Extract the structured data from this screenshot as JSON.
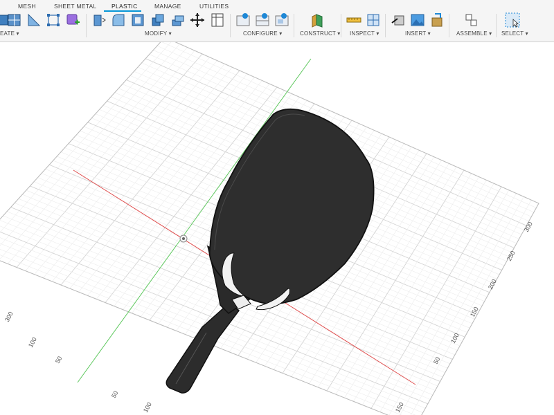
{
  "tabs": [
    {
      "label": "MESH",
      "active": false
    },
    {
      "label": "SHEET METAL",
      "active": false
    },
    {
      "label": "PLASTIC",
      "active": true
    },
    {
      "label": "MANAGE",
      "active": false
    },
    {
      "label": "UTILITIES",
      "active": false
    }
  ],
  "groups": {
    "create": "EATE ▾",
    "modify": "MODIFY ▾",
    "configure": "CONFIGURE ▾",
    "construct": "CONSTRUCT ▾",
    "inspect": "INSPECT ▾",
    "insert": "INSERT ▾",
    "assemble": "ASSEMBLE ▾",
    "select": "SELECT ▾"
  },
  "icons": {
    "create": [
      "box-icon",
      "sketch-grid-icon",
      "revolve-icon",
      "bounding-box-icon",
      "solid-add-icon"
    ],
    "modify": [
      "press-pull-icon",
      "fillet-icon",
      "shell-icon",
      "combine-icon",
      "move-icon",
      "align-icon"
    ],
    "configure": [
      "configure-table-icon",
      "configure-rule-icon",
      "configure-theme-icon"
    ],
    "construct": [
      "offset-plane-icon"
    ],
    "inspect": [
      "measure-icon",
      "section-analysis-icon"
    ],
    "insert": [
      "insert-derive-icon",
      "insert-image-icon",
      "insert-mcmaster-icon"
    ],
    "assemble": [
      "joint-icon"
    ],
    "select": [
      "select-window-icon"
    ]
  },
  "colors": {
    "x_axis": "#e05050",
    "y_axis": "#5ec85e",
    "grid_major": "#d4d4d4",
    "grid_minor": "#ececec",
    "model_fill": "#2c2c2c",
    "model_edge": "#111111",
    "accent": "#0696d7"
  },
  "axis_numbers": {
    "right": [
      "300",
      "250",
      "200",
      "150",
      "100",
      "50"
    ],
    "bottom": [
      "100",
      "50",
      "50",
      "100",
      "150"
    ],
    "partial_top": "300"
  }
}
